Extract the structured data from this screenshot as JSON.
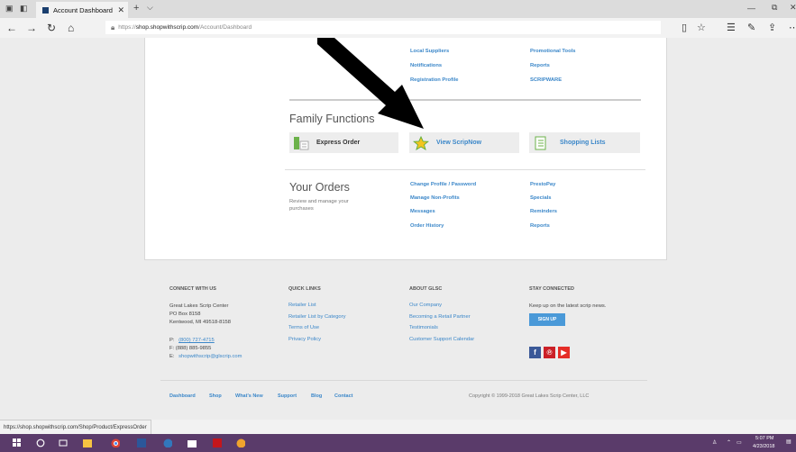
{
  "browser": {
    "tab_title": "Account Dashboard",
    "url_prefix": "https://",
    "url_host": "shop.shopwithscrip.com",
    "url_path": "/Account/Dashboard",
    "status_url": "https://shop.shopwithscrip.com/Shop/Product/ExpressOrder"
  },
  "top_links": {
    "col1": [
      "Local Suppliers",
      "Notifications",
      "Registration Profile"
    ],
    "col2": [
      "Promotional Tools",
      "Reports",
      "SCRIPWARE"
    ]
  },
  "family": {
    "heading": "Family Functions",
    "express": "Express Order",
    "scripnow": "View ScripNow",
    "shopping": "Shopping Lists"
  },
  "orders": {
    "heading": "Your Orders",
    "desc": "Review and manage your purchases",
    "col1": [
      "Change Profile / Password",
      "Manage Non-Profits",
      "Messages",
      "Order History"
    ],
    "col2": [
      "PrestoPay",
      "Specials",
      "Reminders",
      "Reports"
    ]
  },
  "footer": {
    "connect": {
      "heading": "CONNECT WITH US",
      "name": "Great Lakes Scrip Center",
      "addr1": "PO Box 8158",
      "addr2": "Kentwood, MI  49518-8158",
      "phone_label": "P:",
      "phone": "(800) 727-4715",
      "fax": "F:  (888) 885-9855",
      "email_label": "E:",
      "email": "shopwithscrip@glscrip.com"
    },
    "quick": {
      "heading": "QUICK LINKS",
      "links": [
        "Retailer List",
        "Retailer List by Category",
        "Terms of Use",
        "Privacy Policy"
      ]
    },
    "about": {
      "heading": "ABOUT GLSC",
      "links": [
        "Our Company",
        "Becoming a Retail Partner",
        "Testimonials",
        "Customer Support Calendar"
      ]
    },
    "stay": {
      "heading": "STAY CONNECTED",
      "text": "Keep up on the latest scrip news.",
      "signup": "SIGN UP"
    },
    "nav": [
      "Dashboard",
      "Shop",
      "What's New",
      "Support",
      "Blog",
      "Contact"
    ],
    "copyright": "Copyright © 1999-2018 Great Lakes Scrip Center, LLC"
  },
  "taskbar": {
    "time": "5:07 PM",
    "date": "4/23/2018"
  },
  "colors": {
    "link": "#3b87c9",
    "taskbar": "#5a3b6a",
    "signup": "#4a99d8"
  }
}
